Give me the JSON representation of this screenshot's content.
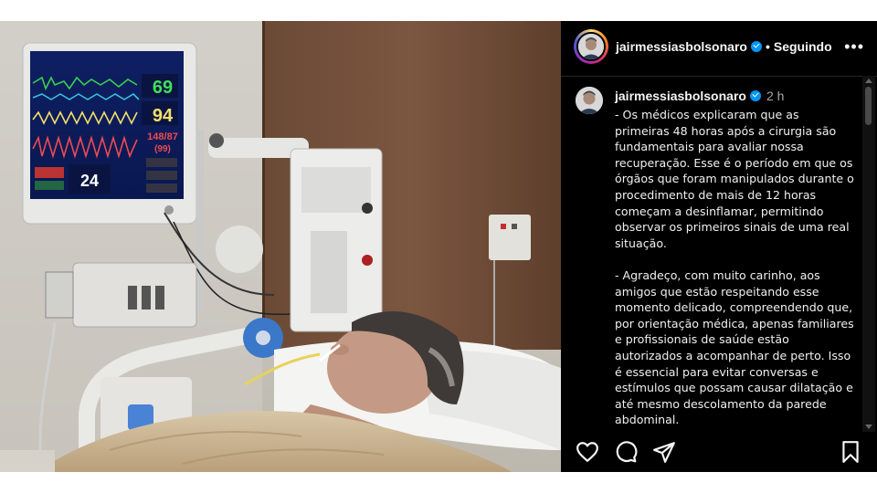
{
  "post": {
    "username": "jairmessiasbolsonaro",
    "follow_status": "Seguindo",
    "more_label": "•••"
  },
  "comment": {
    "username": "jairmessiasbolsonaro",
    "time": "2 h",
    "text": "- Os médicos explicaram que as primeiras 48 horas após a cirurgia são fundamentais para avaliar nossa recuperação. Esse é o período em que os órgãos que foram manipulados durante o procedimento de mais de 12 horas começam a desinflamar, permitindo observar os primeiros sinais de uma real situação.\n\n- Agradeço, com muito carinho, aos amigos que estão respeitando esse momento delicado, compreendendo que, por orientação médica, apenas familiares e profissionais de saúde estão autorizados a acompanhar de perto. Isso é essencial para evitar conversas e estímulos que possam causar dilatação e até mesmo descolamento da parede abdominal."
  },
  "monitor": {
    "hr": "69",
    "spo2": "94",
    "bp": "148/87",
    "bp_mean": "(99)",
    "rr": "24"
  },
  "icons": {
    "like": "heart-icon",
    "comment": "comment-icon",
    "share": "send-icon",
    "save": "bookmark-icon",
    "verified": "verified-badge-icon"
  },
  "colors": {
    "panel_bg": "#000000",
    "verified": "#0095f6",
    "secondary_text": "#a8a8a8"
  }
}
